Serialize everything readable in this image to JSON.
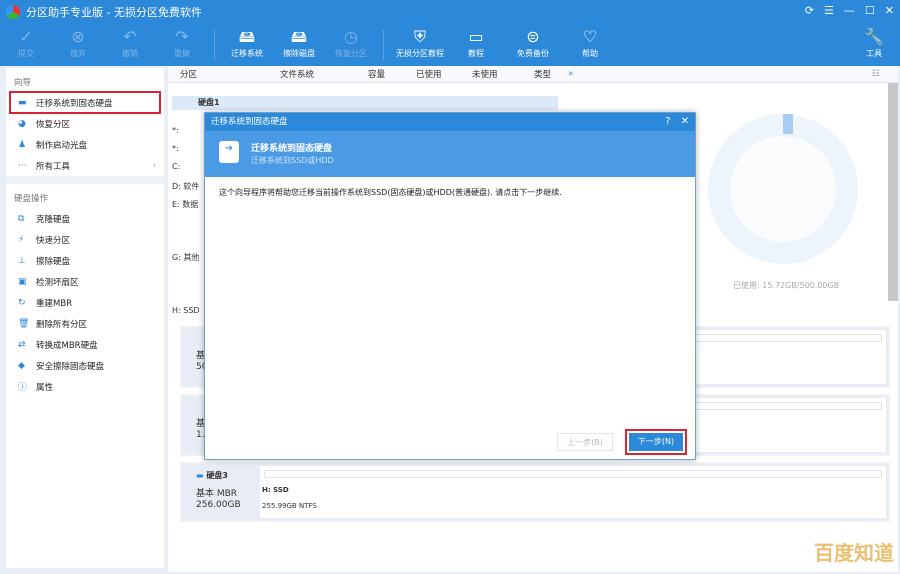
{
  "app": {
    "title": "分区助手专业版 - 无损分区免费软件"
  },
  "toolbar": {
    "items": [
      {
        "label": "提交",
        "icon": "check-icon",
        "enabled": false
      },
      {
        "label": "放弃",
        "icon": "cancel-icon",
        "enabled": false
      },
      {
        "label": "撤销",
        "icon": "undo-icon",
        "enabled": false
      },
      {
        "label": "重做",
        "icon": "redo-icon",
        "enabled": false
      },
      {
        "label": "迁移系统",
        "icon": "migrate-icon",
        "enabled": true
      },
      {
        "label": "擦除磁盘",
        "icon": "wipe-disk-icon",
        "enabled": true
      },
      {
        "label": "恢复分区",
        "icon": "restore-icon",
        "enabled": false
      },
      {
        "label": "无损分区教程",
        "icon": "shield-icon",
        "enabled": true
      },
      {
        "label": "教程",
        "icon": "book-icon",
        "enabled": true
      },
      {
        "label": "免费备份",
        "icon": "backup-icon",
        "enabled": true
      },
      {
        "label": "帮助",
        "icon": "heart-icon",
        "enabled": true
      }
    ],
    "tools_label": "工具"
  },
  "sidebar": {
    "wizard_title": "向导",
    "wizard": [
      {
        "label": "迁移系统到固态硬盘"
      },
      {
        "label": "恢复分区"
      },
      {
        "label": "制作启动光盘"
      },
      {
        "label": "所有工具"
      }
    ],
    "disk_ops_title": "硬盘操作",
    "disk_ops": [
      {
        "label": "克隆硬盘"
      },
      {
        "label": "快速分区"
      },
      {
        "label": "擦除硬盘"
      },
      {
        "label": "检测坏扇区"
      },
      {
        "label": "重建MBR"
      },
      {
        "label": "删除所有分区"
      },
      {
        "label": "转换成MBR硬盘"
      },
      {
        "label": "安全擦除固态硬盘"
      },
      {
        "label": "属性"
      }
    ]
  },
  "table": {
    "columns": [
      "分区",
      "文件系统",
      "容量",
      "已使用",
      "未使用",
      "类型"
    ],
    "disk1": "硬盘1",
    "rows": [
      "*:",
      "*:",
      "C:",
      "D: 软件",
      "E: 数据",
      "G: 其他",
      "H: SSD"
    ],
    "used_text": "已使用: 15.72GB/500.00GB",
    "used_fraction": 0.031
  },
  "cards": [
    {
      "l1": "基",
      "l2": "50"
    },
    {
      "l1": "基",
      "l2": "1."
    },
    {
      "name": "硬盘3",
      "type": "基本 MBR",
      "size": "256.00GB",
      "part": "H: SSD",
      "part_info": "255.99GB NTFS"
    }
  ],
  "dialog": {
    "title": "迁移系统到固态硬盘",
    "heading": "迁移系统到固态硬盘",
    "subheading": "迁移系统到SSD或HDD",
    "body": "这个向导程序将帮助您迁移当前操作系统到SSD(固态硬盘)或HDD(普通硬盘). 请点击下一步继续.",
    "prev": "上一步(B)",
    "next": "下一步(N)"
  },
  "watermark": "百度知道"
}
